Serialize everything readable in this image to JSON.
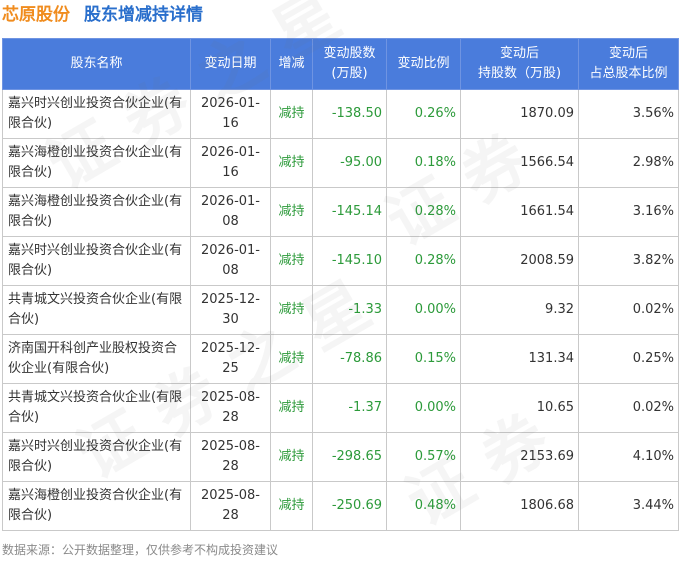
{
  "title": {
    "company": "芯原股份",
    "section": "股东增减持详情"
  },
  "chart_data": {
    "type": "table",
    "columns": [
      {
        "line1": "股东名称",
        "line2": ""
      },
      {
        "line1": "变动日期",
        "line2": ""
      },
      {
        "line1": "增减",
        "line2": ""
      },
      {
        "line1": "变动股数",
        "line2": "(万股)"
      },
      {
        "line1": "变动比例",
        "line2": ""
      },
      {
        "line1": "变动后",
        "line2": "持股数（万股)"
      },
      {
        "line1": "变动后",
        "line2": "占总股本比例"
      }
    ],
    "rows": [
      {
        "name": "嘉兴时兴创业投资合伙企业(有限合伙)",
        "date": "2026-01-16",
        "direction": "减持",
        "change": "-138.50",
        "ratio": "0.26%",
        "after": "1870.09",
        "after_pct": "3.56%"
      },
      {
        "name": "嘉兴海橙创业投资合伙企业(有限合伙)",
        "date": "2026-01-16",
        "direction": "减持",
        "change": "-95.00",
        "ratio": "0.18%",
        "after": "1566.54",
        "after_pct": "2.98%"
      },
      {
        "name": "嘉兴海橙创业投资合伙企业(有限合伙)",
        "date": "2026-01-08",
        "direction": "减持",
        "change": "-145.14",
        "ratio": "0.28%",
        "after": "1661.54",
        "after_pct": "3.16%"
      },
      {
        "name": "嘉兴时兴创业投资合伙企业(有限合伙)",
        "date": "2026-01-08",
        "direction": "减持",
        "change": "-145.10",
        "ratio": "0.28%",
        "after": "2008.59",
        "after_pct": "3.82%"
      },
      {
        "name": "共青城文兴投资合伙企业(有限合伙)",
        "date": "2025-12-30",
        "direction": "减持",
        "change": "-1.33",
        "ratio": "0.00%",
        "after": "9.32",
        "after_pct": "0.02%"
      },
      {
        "name": "济南国开科创产业股权投资合伙企业(有限合伙)",
        "date": "2025-12-25",
        "direction": "减持",
        "change": "-78.86",
        "ratio": "0.15%",
        "after": "131.34",
        "after_pct": "0.25%"
      },
      {
        "name": "共青城文兴投资合伙企业(有限合伙)",
        "date": "2025-08-28",
        "direction": "减持",
        "change": "-1.37",
        "ratio": "0.00%",
        "after": "10.65",
        "after_pct": "0.02%"
      },
      {
        "name": "嘉兴时兴创业投资合伙企业(有限合伙)",
        "date": "2025-08-28",
        "direction": "减持",
        "change": "-298.65",
        "ratio": "0.57%",
        "after": "2153.69",
        "after_pct": "4.10%"
      },
      {
        "name": "嘉兴海橙创业投资合伙企业(有限合伙)",
        "date": "2025-08-28",
        "direction": "减持",
        "change": "-250.69",
        "ratio": "0.48%",
        "after": "1806.68",
        "after_pct": "3.44%"
      }
    ]
  },
  "footer": "数据来源：公开数据整理，仅供参考不构成投资建议",
  "colors": {
    "header_bg": "#4a7cdc",
    "company_title": "#f08c1e",
    "section_title": "#2a6fcc",
    "decrease_text": "#2c9a3a"
  }
}
